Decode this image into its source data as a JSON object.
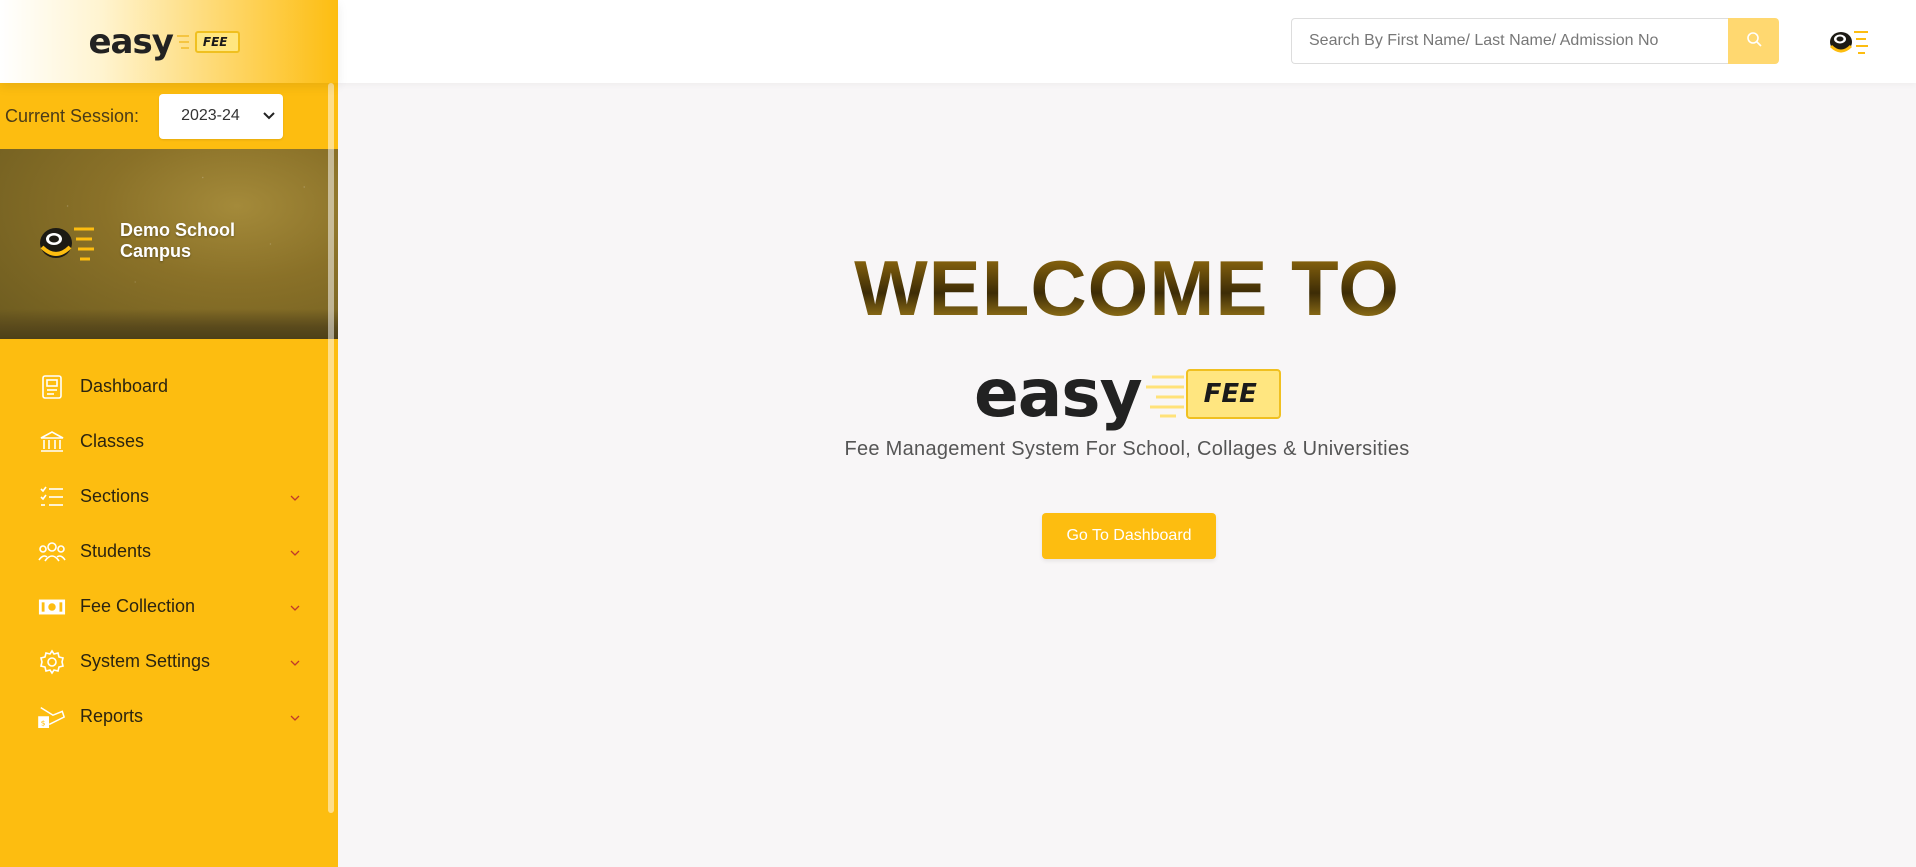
{
  "app": {
    "logo_text": "easy",
    "logo_badge": "FEE"
  },
  "session": {
    "label": "Current Session:",
    "selected": "2023-24"
  },
  "campus": {
    "name": "Demo School Campus"
  },
  "sidebar": {
    "items": [
      {
        "label": "Dashboard",
        "icon": "dashboard-icon",
        "has_submenu": false
      },
      {
        "label": "Classes",
        "icon": "classes-icon",
        "has_submenu": false
      },
      {
        "label": "Sections",
        "icon": "sections-icon",
        "has_submenu": true
      },
      {
        "label": "Students",
        "icon": "students-icon",
        "has_submenu": true
      },
      {
        "label": "Fee Collection",
        "icon": "fee-collection-icon",
        "has_submenu": true
      },
      {
        "label": "System Settings",
        "icon": "settings-icon",
        "has_submenu": true
      },
      {
        "label": "Reports",
        "icon": "reports-icon",
        "has_submenu": true
      }
    ]
  },
  "header": {
    "search_placeholder": "Search By First Name/ Last Name/ Admission No"
  },
  "main": {
    "welcome": "WELCOME TO",
    "brand_text": "easy",
    "brand_badge": "FEE",
    "tagline": "Fee Management System For School, Collages & Universities",
    "cta_label": "Go To Dashboard"
  },
  "colors": {
    "primary": "#fdbd10",
    "search_button": "#ffd870",
    "chevron": "#c0392b"
  }
}
